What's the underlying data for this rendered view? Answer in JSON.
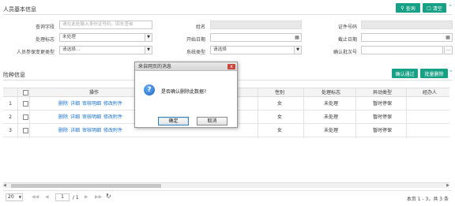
{
  "section1": {
    "title": "人员基本信息",
    "query_label": "查询",
    "reset_label": "清空"
  },
  "form": {
    "query_field": {
      "label": "查询字段",
      "placeholder": "请在此处输入身份证号码，回车查询"
    },
    "name": {
      "label": "姓名"
    },
    "id_no": {
      "label": "证件号码"
    },
    "status": {
      "label": "处理标志",
      "value": "未处理"
    },
    "start_date": {
      "label": "开始日期"
    },
    "end_date": {
      "label": "截止日期"
    },
    "change_type": {
      "label": "人员参保变更类型",
      "value": "请选择..."
    },
    "sys_type": {
      "label": "系统类型",
      "value": "请选择"
    },
    "batch_no": {
      "label": "确认批次号"
    }
  },
  "section2": {
    "title": "险种信息",
    "confirm_label": "确认通过",
    "batch_delete_label": "批量删除"
  },
  "table": {
    "headers": {
      "op": "操作",
      "gender": "性别",
      "status": "处理标志",
      "change": "异动类型",
      "handler": "经办人"
    },
    "actions": {
      "delete": "删除",
      "detail": "详细",
      "audit": "审核明细",
      "edit": "修改附件"
    },
    "rows": [
      {
        "no": "1",
        "gender": "女",
        "status": "未处理",
        "change": "暂时停保",
        "handler": ""
      },
      {
        "no": "2",
        "gender": "女",
        "status": "未处理",
        "change": "暂时停保",
        "handler": ""
      },
      {
        "no": "3",
        "gender": "女",
        "status": "未处理",
        "change": "暂时停保",
        "handler": ""
      }
    ]
  },
  "pager": {
    "page_size": "20",
    "current_page": "1",
    "total_pages": "/ 1",
    "summary": "本页 1 - 3，共 3 条"
  },
  "dialog": {
    "title": "来自网页的消息",
    "message": "是否确认删除此数据?",
    "ok": "确定",
    "cancel": "取消",
    "close": "x"
  },
  "colors": {
    "accent": "#16a085",
    "link": "#1a73c9"
  }
}
